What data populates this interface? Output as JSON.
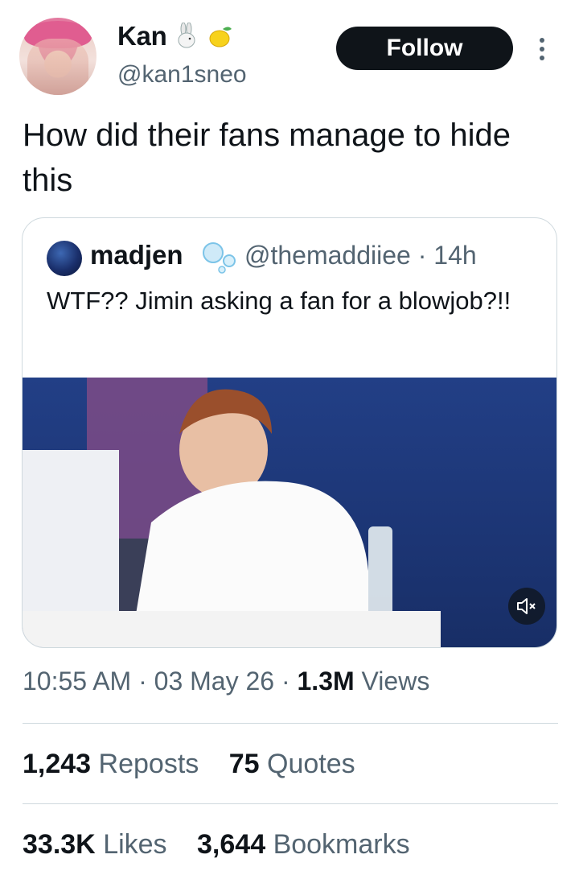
{
  "author": {
    "display_name": "Kan",
    "handle": "@kan1sneo",
    "emojis": [
      "rabbit-emoji",
      "lemon-emoji"
    ]
  },
  "follow_label": "Follow",
  "tweet_text": "How did their fans manage to hide this",
  "quoted_tweet": {
    "display_name": "madjen",
    "handle": "@themaddiiee",
    "time_ago": "14h",
    "text": "WTF?? Jimin asking a fan for a blowjob?!!",
    "media_icon": "mute-icon"
  },
  "meta": {
    "time": "10:55 AM",
    "date": "03 May 26",
    "views_count": "1.3M",
    "views_label": "Views"
  },
  "stats": {
    "reposts_count": "1,243",
    "reposts_label": "Reposts",
    "quotes_count": "75",
    "quotes_label": "Quotes",
    "likes_count": "33.3K",
    "likes_label": "Likes",
    "bookmarks_count": "3,644",
    "bookmarks_label": "Bookmarks"
  },
  "colors": {
    "text_primary": "#0f1419",
    "text_secondary": "#536471",
    "border": "#cfd9de",
    "follow_bg": "#0f1419"
  }
}
